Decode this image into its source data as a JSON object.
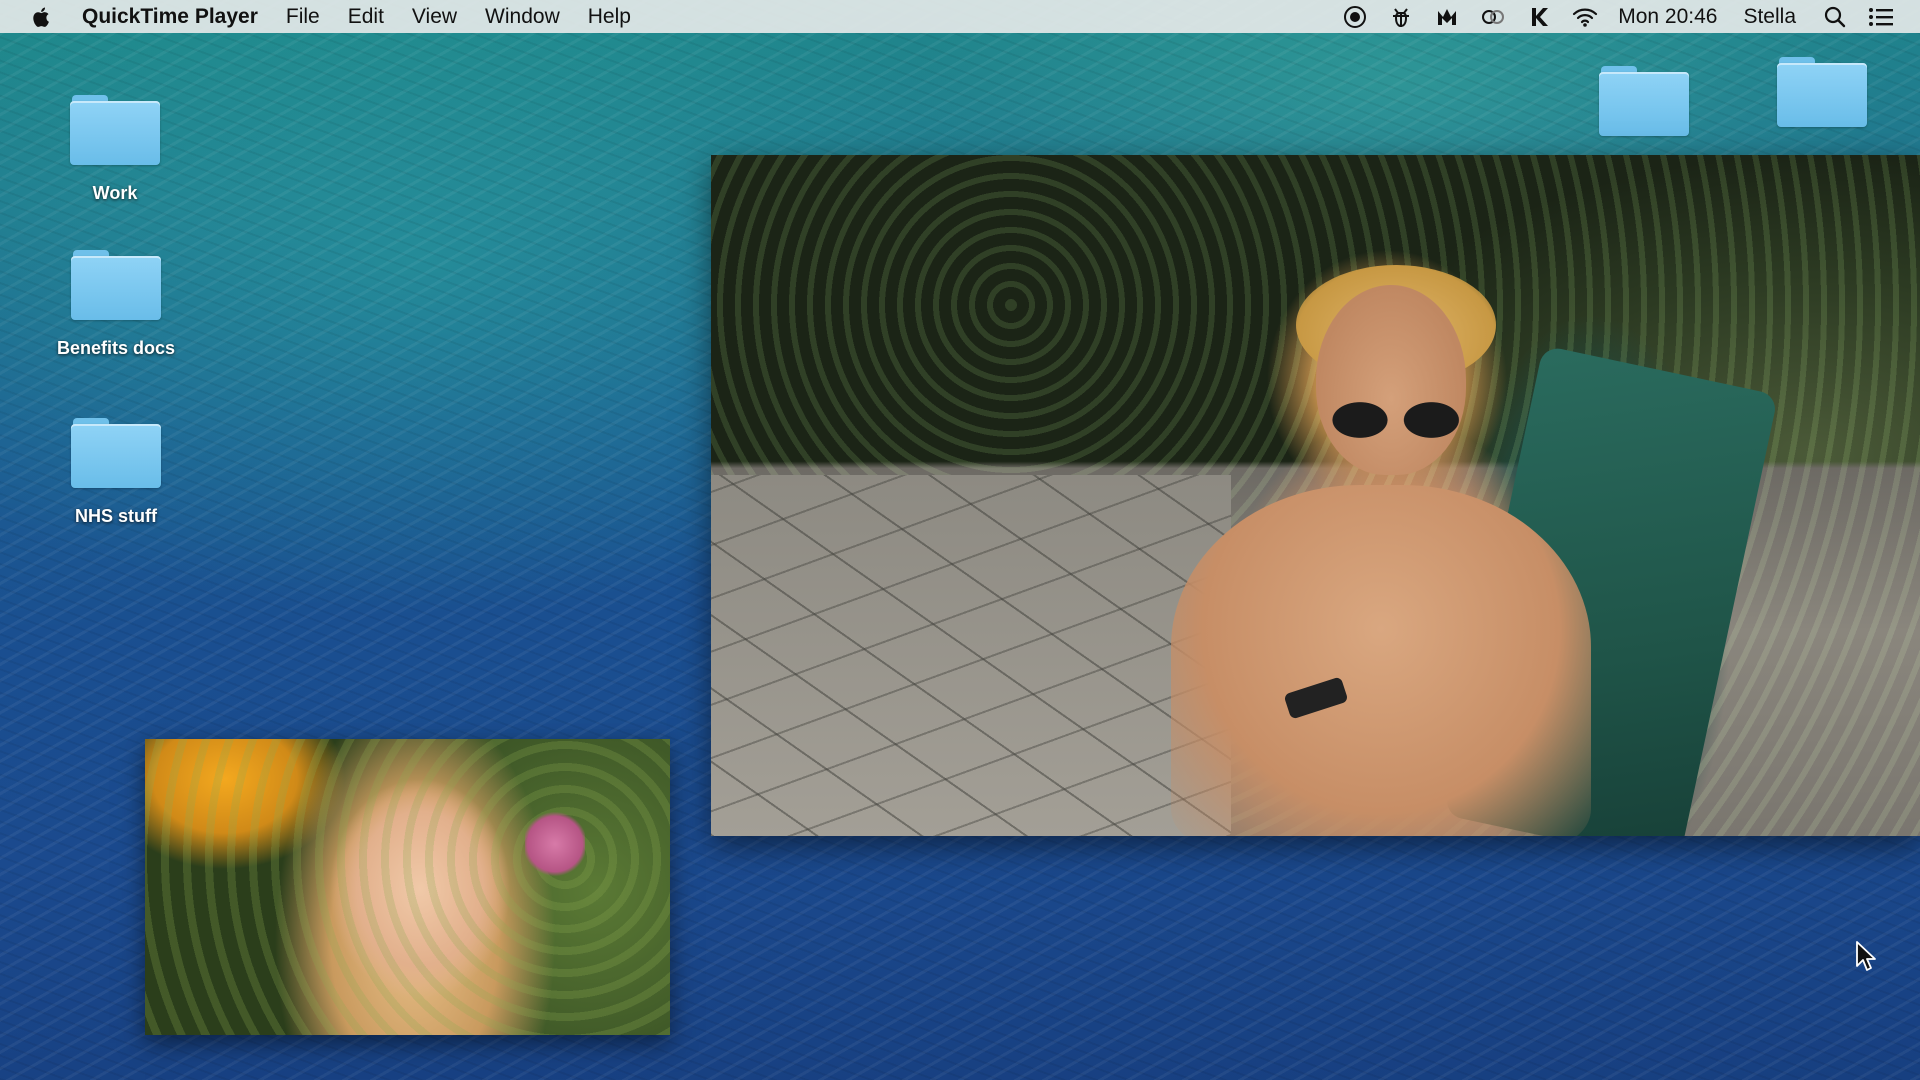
{
  "menubar": {
    "app_name": "QuickTime Player",
    "menus": [
      "File",
      "Edit",
      "View",
      "Window",
      "Help"
    ],
    "status_icons": [
      "screen-record-icon",
      "bug-icon",
      "malwarebytes-icon",
      "cloud-icon",
      "klack-icon",
      "wifi-icon"
    ],
    "clock": "Mon 20:46",
    "user": "Stella"
  },
  "desktop": {
    "icons": [
      {
        "label": "Work"
      },
      {
        "label": "Benefits docs"
      },
      {
        "label": "NHS stuff"
      },
      {
        "label": ""
      },
      {
        "label": ""
      }
    ]
  },
  "colors": {
    "folder": "#6fc0ea",
    "menubar": "#e4e8e8"
  }
}
